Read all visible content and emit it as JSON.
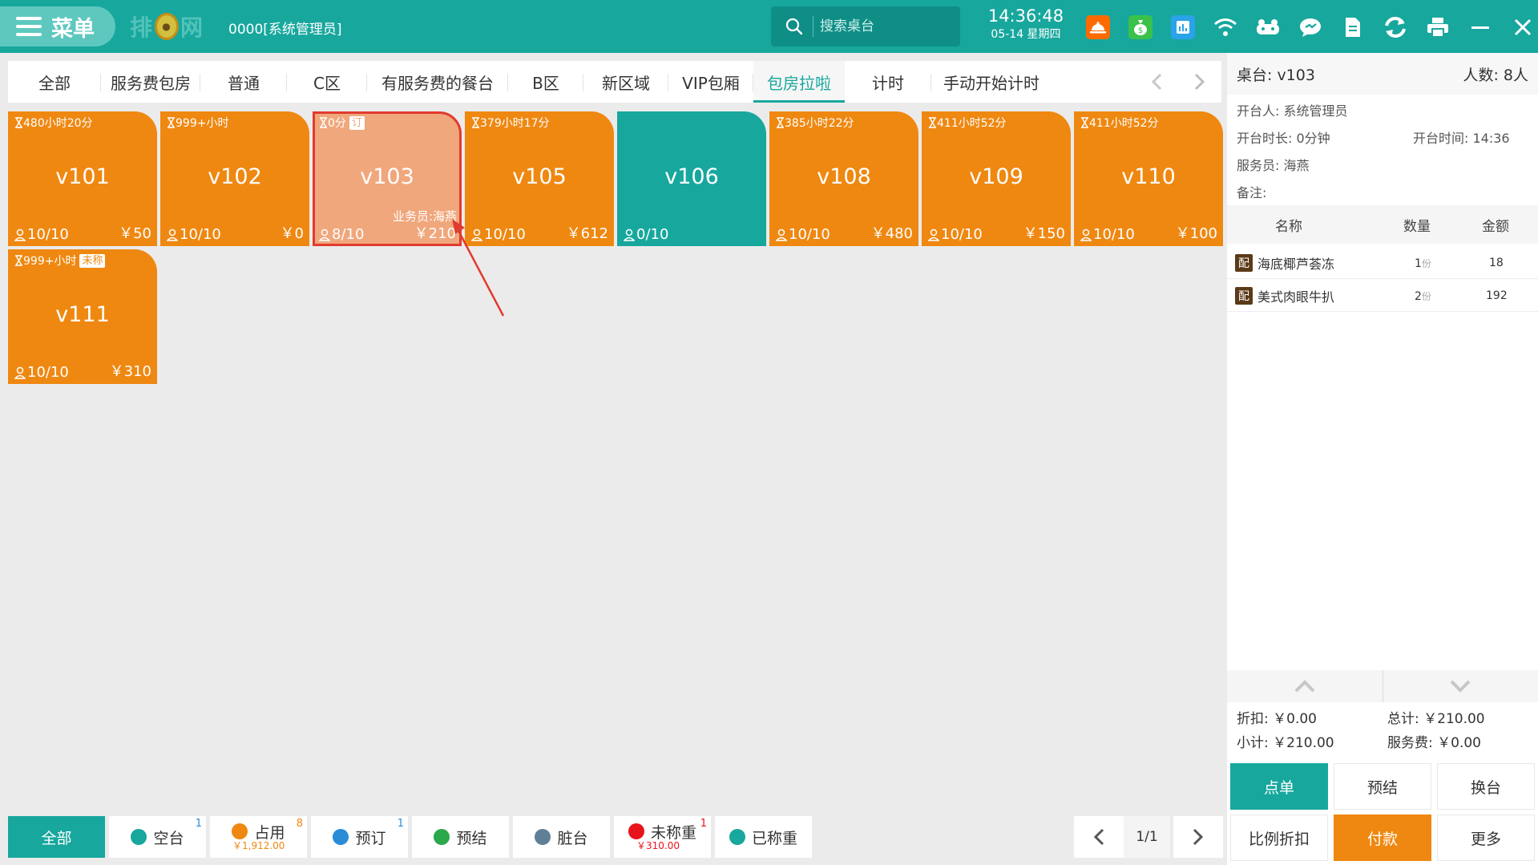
{
  "topbar": {
    "menu_label": "菜单",
    "logo_text_1": "排",
    "logo_text_2": "网",
    "user": "0000[系统管理员]",
    "search_placeholder": "搜索桌台",
    "time": "14:36:48",
    "date": "05-14 星期四",
    "icons": [
      "service-bell-icon",
      "money-bag-icon",
      "report-icon",
      "wifi-icon",
      "gamepad-icon",
      "chat-icon",
      "document-icon",
      "sync-icon",
      "printer-icon",
      "minimize-icon",
      "close-icon"
    ],
    "colors": {
      "bar": "#17a79d",
      "bell_bg": "#ff6a00",
      "money_bg": "#3ac14a",
      "report_bg": "#2aa3e8"
    }
  },
  "tabs": [
    "全部",
    "服务费包房",
    "普通",
    "C区",
    "有服务费的餐台",
    "B区",
    "新区域",
    "VIP包厢",
    "包房拉啦",
    "计时",
    "手动开始计时"
  ],
  "active_tab": "包房拉啦",
  "cards": [
    {
      "top": "480小时20分",
      "badge": "",
      "name": "v101",
      "guests": "10/10",
      "amount": "￥50",
      "staff": "",
      "status": "occupied"
    },
    {
      "top": "999+小时",
      "badge": "",
      "name": "v102",
      "guests": "10/10",
      "amount": "￥0",
      "staff": "",
      "status": "occupied"
    },
    {
      "top": "0分",
      "badge": "订",
      "name": "v103",
      "guests": "8/10",
      "amount": "￥210",
      "staff": "业务员:海燕",
      "status": "selected"
    },
    {
      "top": "379小时17分",
      "badge": "",
      "name": "v105",
      "guests": "10/10",
      "amount": "￥612",
      "staff": "",
      "status": "occupied"
    },
    {
      "top": "",
      "badge": "",
      "name": "v106",
      "guests": "0/10",
      "amount": "",
      "staff": "",
      "status": "free"
    },
    {
      "top": "385小时22分",
      "badge": "",
      "name": "v108",
      "guests": "10/10",
      "amount": "￥480",
      "staff": "",
      "status": "occupied"
    },
    {
      "top": "411小时52分",
      "badge": "",
      "name": "v109",
      "guests": "10/10",
      "amount": "￥150",
      "staff": "",
      "status": "occupied"
    },
    {
      "top": "411小时52分",
      "badge": "",
      "name": "v110",
      "guests": "10/10",
      "amount": "￥100",
      "staff": "",
      "status": "occupied"
    },
    {
      "top": "999+小时",
      "badge": "未称",
      "name": "v111",
      "guests": "10/10",
      "amount": "￥310",
      "staff": "",
      "status": "occupied"
    }
  ],
  "panel": {
    "table": "桌台: v103",
    "people": "人数: 8人",
    "opener": "开台人: 系统管理员",
    "duration": "开台时长: 0分钟",
    "open_time": "开台时间:  14:36",
    "waiter": "服务员: 海燕",
    "note": "备注:",
    "columns": {
      "name": "名称",
      "qty": "数量",
      "amount": "金额"
    },
    "items": [
      {
        "tag": "配",
        "name": "海底椰芦荟冻",
        "qty": "1",
        "unit": "份",
        "amount": "18"
      },
      {
        "tag": "配",
        "name": "美式肉眼牛扒",
        "qty": "2",
        "unit": "份",
        "amount": "192"
      }
    ],
    "discount": "折扣: ￥0.00",
    "total": "总计: ￥210.00",
    "subtotal": "小计: ￥210.00",
    "service_fee": "服务费: ￥0.00",
    "buttons": {
      "order": "点单",
      "prebill": "预结",
      "change": "换台",
      "ratio_discount": "比例折扣",
      "pay": "付款",
      "more": "更多"
    }
  },
  "statusbar": {
    "all": "全部",
    "items": [
      {
        "label": "空台",
        "count": "1",
        "sub": "",
        "color": "#17a79d"
      },
      {
        "label": "占用",
        "count": "8",
        "sub": "￥1,912.00",
        "color": "#ef8811"
      },
      {
        "label": "预订",
        "count": "1",
        "sub": "",
        "color": "#2a8bd6"
      },
      {
        "label": "预结",
        "count": "",
        "sub": "",
        "color": "#2aa84a"
      },
      {
        "label": "脏台",
        "count": "",
        "sub": "",
        "color": "#5f7f96"
      },
      {
        "label": "未称重",
        "count": "1",
        "sub": "￥310.00",
        "color": "#e8141c"
      },
      {
        "label": "已称重",
        "count": "",
        "sub": "",
        "color": "#17a79d"
      }
    ],
    "page": "1/1"
  }
}
